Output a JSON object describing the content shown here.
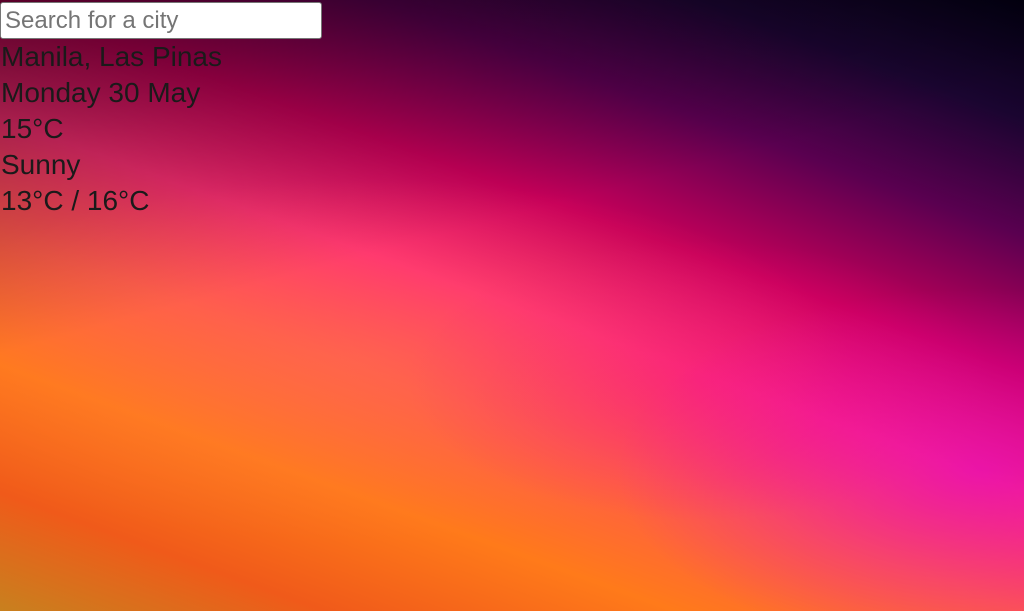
{
  "search": {
    "placeholder": "Search for a city",
    "value": ""
  },
  "weather": {
    "location": "Manila, Las Pinas",
    "date": "Monday 30 May",
    "temperature": "15°C",
    "condition": "Sunny",
    "range": "13°C / 16°C"
  },
  "colors": {
    "background_top_right": "#020010",
    "background_mid": "#ff2f74",
    "background_bottom_left": "#c8801e",
    "text": "#1a1a1a"
  }
}
